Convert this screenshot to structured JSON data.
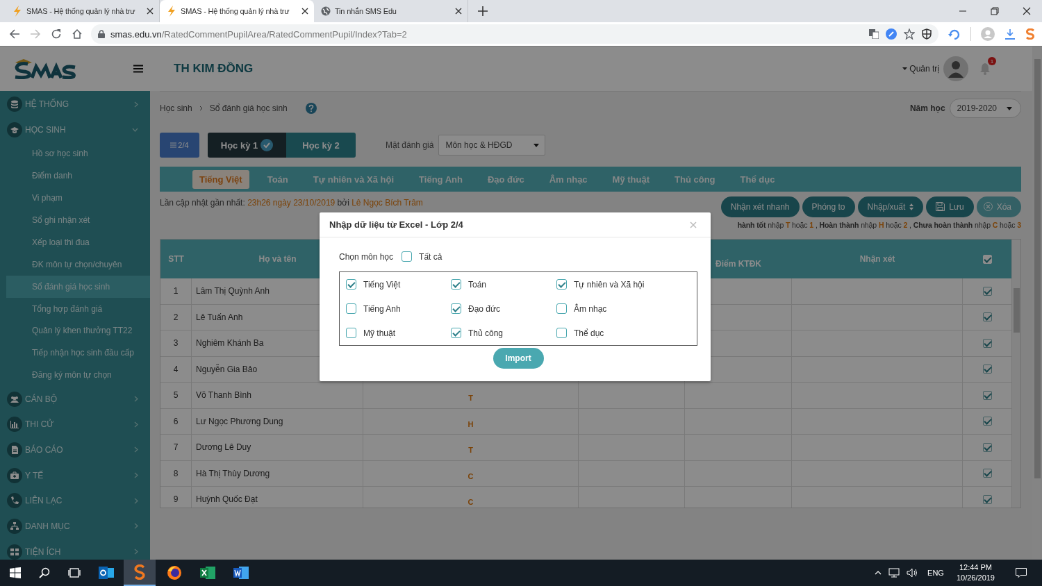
{
  "browser": {
    "tabs": [
      {
        "title": "SMAS - Hệ thống quản lý nhà trư",
        "selected": false,
        "kind": "smas"
      },
      {
        "title": "SMAS - Hệ thống quản lý nhà trư",
        "selected": true,
        "kind": "smas"
      },
      {
        "title": "Tin nhắn SMS Edu",
        "selected": false,
        "kind": "globe"
      }
    ],
    "url_host": "smas.edu.vn",
    "url_path": "/RatedCommentPupilArea/RatedCommentPupil/Index?Tab=2"
  },
  "header": {
    "school": "TH KIM ĐỒNG",
    "user": "Quản trị",
    "notification_count": "1"
  },
  "sidebar": {
    "items": [
      {
        "label": "HỆ THỐNG",
        "expanded": false
      },
      {
        "label": "HỌC SINH",
        "expanded": true,
        "children": [
          {
            "label": "Hồ sơ học sinh",
            "selected": false
          },
          {
            "label": "Điểm danh",
            "selected": false
          },
          {
            "label": "Vi phạm",
            "selected": false
          },
          {
            "label": "Sổ ghi nhận xét",
            "selected": false
          },
          {
            "label": "Xếp loại thi đua",
            "selected": false
          },
          {
            "label": "ĐK môn tự chọn/chuyên",
            "selected": false
          },
          {
            "label": "Sổ đánh giá học sinh",
            "selected": true
          },
          {
            "label": "Tổng hợp đánh giá",
            "selected": false
          },
          {
            "label": "Quản lý khen thưởng TT22",
            "selected": false
          },
          {
            "label": "Tiếp nhận học sinh đầu cấp",
            "selected": false
          },
          {
            "label": "Đăng ký môn tự chọn",
            "selected": false
          }
        ]
      },
      {
        "label": "CÁN BỘ",
        "expanded": false
      },
      {
        "label": "THI CỬ",
        "expanded": false
      },
      {
        "label": "BÁO CÁO",
        "expanded": false
      },
      {
        "label": "Y TẾ",
        "expanded": false
      },
      {
        "label": "LIÊN LẠC",
        "expanded": false
      },
      {
        "label": "DANH MỤC",
        "expanded": false
      },
      {
        "label": "TIỆN ÍCH",
        "expanded": false
      }
    ]
  },
  "breadcrumb": [
    "Học sinh",
    "Sổ đánh giá học sinh"
  ],
  "school_year": {
    "label": "Năm học",
    "value": "2019-2020"
  },
  "class_button": "2/4",
  "semesters": [
    {
      "label": "Học kỳ 1",
      "selected": true
    },
    {
      "label": "Học kỳ 2",
      "selected": false
    }
  ],
  "aspect": {
    "label": "Mặt đánh giá",
    "value": "Môn học & HĐGD"
  },
  "subject_tabs": [
    {
      "label": "Tiếng Việt",
      "selected": true
    },
    {
      "label": "Toán",
      "selected": false
    },
    {
      "label": "Tự nhiên và Xã hội",
      "selected": false
    },
    {
      "label": "Tiếng Anh",
      "selected": false
    },
    {
      "label": "Đạo đức",
      "selected": false
    },
    {
      "label": "Âm nhạc",
      "selected": false
    },
    {
      "label": "Mỹ thuật",
      "selected": false
    },
    {
      "label": "Thủ công",
      "selected": false
    },
    {
      "label": "Thể dục",
      "selected": false
    }
  ],
  "last_update": {
    "label": "Lần cập nhật gần nhất:",
    "time": "23h26 ngày 23/10/2019",
    "by": "bởi",
    "user": "Lê Ngọc Bích Trâm"
  },
  "actions": [
    {
      "label": "Nhận xét nhanh",
      "kind": "plain",
      "disabled": false
    },
    {
      "label": "Phóng to",
      "kind": "plain",
      "disabled": false
    },
    {
      "label": "Nhập/xuất",
      "kind": "dropdown",
      "disabled": false
    },
    {
      "label": "Lưu",
      "kind": "save",
      "disabled": false
    },
    {
      "label": "Xóa",
      "kind": "delete",
      "disabled": true
    }
  ],
  "legend": [
    {
      "text": "hành tốt",
      "kind": "bold"
    },
    {
      "text": "nhập",
      "kind": "plain"
    },
    {
      "text": "T",
      "kind": "code"
    },
    {
      "text": "hoặc",
      "kind": "plain"
    },
    {
      "text": "1",
      "kind": "code"
    },
    {
      "text": ",",
      "kind": "plain"
    },
    {
      "text": "Hoàn thành",
      "kind": "bold"
    },
    {
      "text": "nhập",
      "kind": "plain"
    },
    {
      "text": "H",
      "kind": "code"
    },
    {
      "text": "hoặc",
      "kind": "plain"
    },
    {
      "text": "2",
      "kind": "code"
    },
    {
      "text": ",",
      "kind": "plain"
    },
    {
      "text": "Chưa hoàn thành",
      "kind": "bold"
    },
    {
      "text": "nhập",
      "kind": "plain"
    },
    {
      "text": "C",
      "kind": "code"
    },
    {
      "text": "hoặc",
      "kind": "plain"
    },
    {
      "text": "3",
      "kind": "code"
    }
  ],
  "table": {
    "stt": "STT",
    "name": "Họ và tên",
    "score": "Điểm KTĐK",
    "comment": "Nhận xét",
    "select_all_checked": true,
    "rows": [
      {
        "stt": "1",
        "name": "Lâm Thị Quỳnh Anh",
        "checked": true
      },
      {
        "stt": "2",
        "name": "Lê Tuấn Anh",
        "checked": true
      },
      {
        "stt": "3",
        "name": "Nghiêm Khánh Ba",
        "checked": true
      },
      {
        "stt": "4",
        "name": "Nguyễn Gia Bảo",
        "checked": true
      },
      {
        "stt": "5",
        "name": "Võ Thanh Bình",
        "column_3": "T",
        "checked": true
      },
      {
        "stt": "6",
        "name": "Lư Ngọc Phương Dung",
        "column_3": "H",
        "checked": true
      },
      {
        "stt": "7",
        "name": "Dương Lê Duy",
        "column_3": "T",
        "checked": true
      },
      {
        "stt": "8",
        "name": "Hà Thị Thùy Dương",
        "column_3": "C",
        "checked": true
      },
      {
        "stt": "9",
        "name": "Huỳnh Quốc Đạt",
        "column_3": "C",
        "checked": true
      }
    ]
  },
  "modal": {
    "title": "Nhập dữ liệu từ Excel - Lớp 2/4",
    "subject_label": "Chọn môn học",
    "all": {
      "label": "Tất cả",
      "checked": false
    },
    "subjects": [
      {
        "label": "Tiếng Việt",
        "checked": true
      },
      {
        "label": "Toán",
        "checked": true
      },
      {
        "label": "Tự nhiên và Xã hội",
        "checked": true
      },
      {
        "label": "Tiếng Anh",
        "checked": false
      },
      {
        "label": "Đạo đức",
        "checked": true
      },
      {
        "label": "Âm nhạc",
        "checked": false
      },
      {
        "label": "Mỹ thuật",
        "checked": false
      },
      {
        "label": "Thủ công",
        "checked": true
      },
      {
        "label": "Thể dục",
        "checked": false
      }
    ],
    "button": "Import"
  },
  "taskbar": {
    "language": "ENG",
    "time": "12:44 PM",
    "date": "10/26/2019"
  }
}
